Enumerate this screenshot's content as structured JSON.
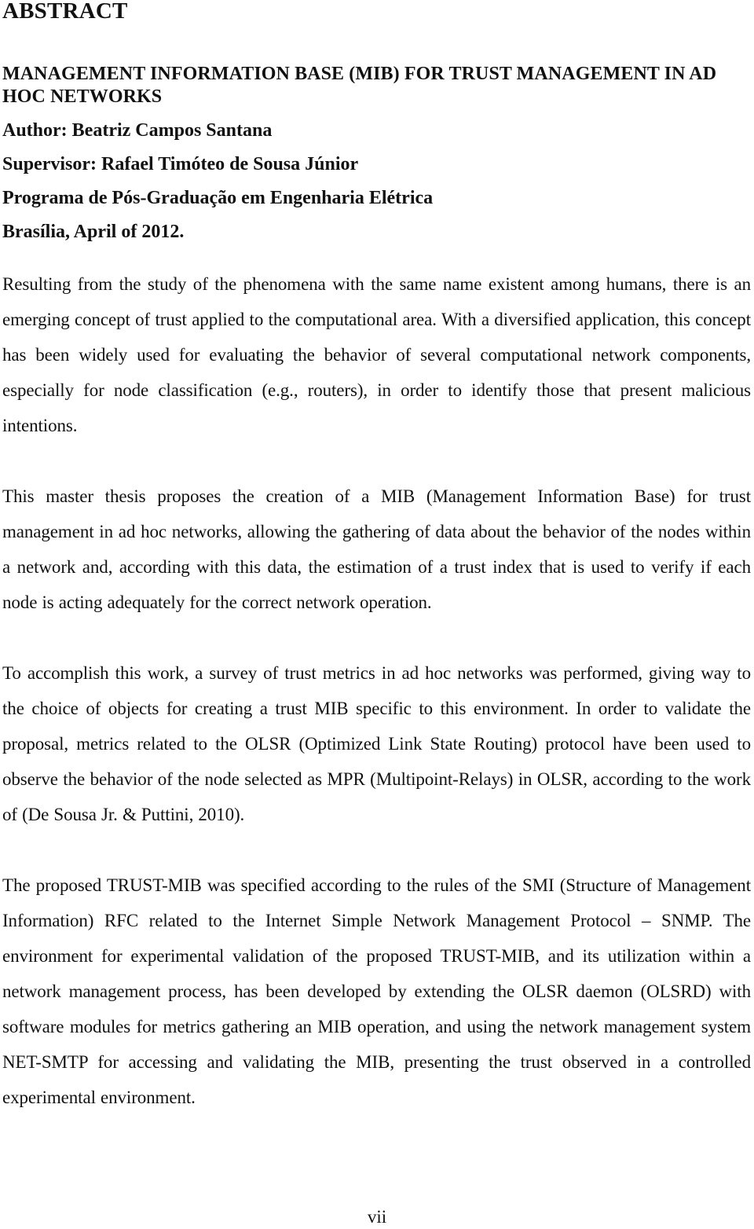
{
  "document": {
    "heading": "ABSTRACT",
    "title": "MANAGEMENT INFORMATION BASE (MIB) FOR TRUST MANAGEMENT IN AD HOC NETWORKS",
    "author": "Author: Beatriz Campos Santana",
    "supervisor": "Supervisor: Rafael Timóteo de Sousa Júnior",
    "program": "Programa de Pós-Graduação em Engenharia Elétrica",
    "place_date": "Brasília, April of 2012.",
    "paragraphs": [
      "Resulting from the study of the phenomena with the same name existent among humans, there is an emerging concept of trust applied to the computational area. With a diversified application, this concept has been widely used for evaluating the behavior of several computational network components, especially for node classification (e.g., routers), in order to identify those that present malicious intentions.",
      "This master thesis proposes the creation of a MIB (Management Information Base) for trust management in ad hoc networks, allowing the gathering of data about the behavior of the nodes within a network and, according with this data, the estimation of a trust index that is used to verify if each node is acting adequately for the correct network operation.",
      "To accomplish this work, a survey of trust metrics in ad hoc networks was performed, giving way to the choice of objects for creating a trust MIB specific to this environment. In order to validate the proposal, metrics related to the OLSR (Optimized Link State Routing) protocol have been used to observe the behavior of the node selected as MPR (Multipoint-Relays) in OLSR, according to the work of (De Sousa Jr. & Puttini, 2010).",
      "The proposed TRUST-MIB was specified according to the rules of the SMI (Structure of Management Information) RFC related to the Internet Simple Network Management Protocol – SNMP. The environment for experimental validation of the proposed TRUST-MIB, and its utilization within a network management process, has been developed by extending the OLSR daemon (OLSRD) with software modules for metrics gathering an MIB operation, and using the network management system NET-SMTP for accessing and validating the MIB, presenting the trust observed in a controlled experimental environment."
    ],
    "page_number": "vii"
  }
}
